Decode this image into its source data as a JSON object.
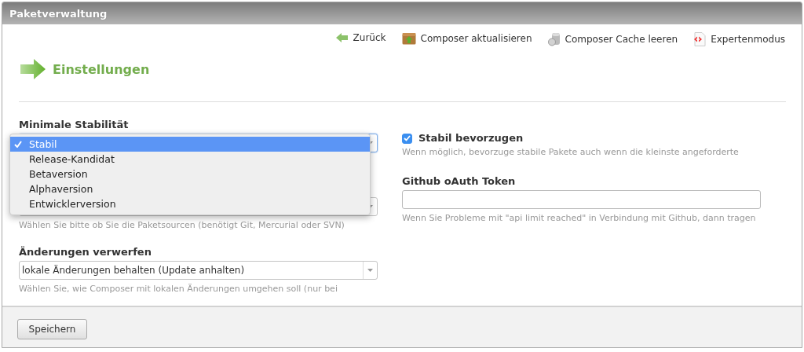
{
  "window": {
    "title": "Paketverwaltung"
  },
  "toolbar": [
    {
      "kind": "back",
      "label": "Zurück"
    },
    {
      "kind": "update",
      "label": "Composer aktualisieren"
    },
    {
      "kind": "cache",
      "label": "Composer Cache leeren"
    },
    {
      "kind": "expert",
      "label": "Expertenmodus"
    }
  ],
  "heading": "Einstellungen",
  "left_fields": [
    {
      "kind": "select",
      "label": "Minimale Stabilität",
      "open": true,
      "options": [
        {
          "label": "Stabil",
          "selected": true
        },
        {
          "label": "Release-Kandidat",
          "selected": false
        },
        {
          "label": "Betaversion",
          "selected": false
        },
        {
          "label": "Alphaversion",
          "selected": false
        },
        {
          "label": "Entwicklerversion",
          "selected": false
        }
      ]
    },
    {
      "kind": "select",
      "help": "Wählen Sie bitte ob Sie die Paketsourcen (benötigt Git, Mercurial oder SVN)"
    },
    {
      "kind": "select",
      "label": "Änderungen verwerfen",
      "value": "lokale Änderungen behalten (Update anhalten)",
      "help": "Wählen Sie, wie Composer mit lokalen Änderungen umgehen soll (nur bei"
    }
  ],
  "right_fields": [
    {
      "kind": "checkbox",
      "label": "Stabil bevorzugen",
      "checked": true,
      "help": "Wenn möglich, bevorzuge stabile Pakete auch wenn die kleinste angeforderte"
    },
    {
      "kind": "text",
      "label": "Github oAuth Token",
      "help": "Wenn Sie Probleme mit \"api limit reached\" in Verbindung mit Github, dann tragen"
    }
  ],
  "buttons": [
    {
      "label": "Speichern"
    }
  ]
}
